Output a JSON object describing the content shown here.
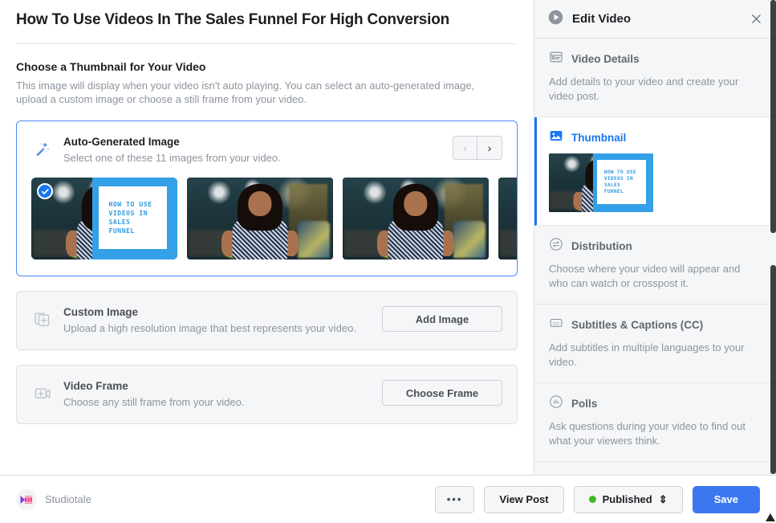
{
  "main": {
    "page_title": "How To Use Videos In The Sales Funnel For High Conversion",
    "section_title": "Choose a Thumbnail for Your Video",
    "section_sub": "This image will display when your video isn't auto playing. You can select an auto-generated image, upload a custom image or choose a still frame from your video.",
    "cards": [
      {
        "id": "auto-generated-image",
        "icon": "magic-wand-icon",
        "title": "Auto-Generated Image",
        "desc": "Select one of these 11 images from your video.",
        "prev_label": "‹",
        "next_label": "›"
      },
      {
        "id": "custom-image",
        "icon": "add-image-icon",
        "title": "Custom Image",
        "desc": "Upload a high resolution image that best represents your video.",
        "button_label": "Add Image"
      },
      {
        "id": "video-frame",
        "icon": "add-video-frame-icon",
        "title": "Video Frame",
        "desc": "Choose any still frame from your video.",
        "button_label": "Choose Frame"
      }
    ],
    "thumbnail_overlay_text": "How To Use\nVideos In\nSales\nFunnel",
    "thumbnails": [
      {
        "index": 1,
        "selected": true,
        "has_overlay": true
      },
      {
        "index": 2,
        "selected": false,
        "has_overlay": false
      },
      {
        "index": 3,
        "selected": false,
        "has_overlay": false
      },
      {
        "index": 4,
        "selected": false,
        "has_overlay": false
      }
    ]
  },
  "sidebar": {
    "title": "Edit Video",
    "title_icon": "play-circle-icon",
    "close_icon": "close-icon",
    "items": [
      {
        "icon": "video-details-icon",
        "label": "Video Details",
        "desc": "Add details to your video and create your video post.",
        "active": false
      },
      {
        "icon": "image-icon",
        "label": "Thumbnail",
        "desc": "",
        "active": true
      },
      {
        "icon": "distribution-icon",
        "label": "Distribution",
        "desc": "Choose where your video will appear and who can watch or crosspost it.",
        "active": false
      },
      {
        "icon": "cc-icon",
        "label": "Subtitles & Captions (CC)",
        "desc": "Add subtitles in multiple languages to your video.",
        "active": false
      },
      {
        "icon": "polls-icon",
        "label": "Polls",
        "desc": "Ask questions during your video to find out what your viewers think.",
        "active": false
      }
    ]
  },
  "footer": {
    "brand_name": "Studiotale",
    "brand_icon": "studiotale-logo",
    "more_label": "•••",
    "view_post_label": "View Post",
    "status_label": "Published",
    "status_caret": "⇕",
    "status_color": "#42b72a",
    "save_label": "Save"
  },
  "colors": {
    "accent_blue": "#1877f2",
    "save_blue": "#3b78f0",
    "overlay_blue": "#34a0e8",
    "muted_text": "#8d949e",
    "panel_bg": "#f5f6f7"
  }
}
